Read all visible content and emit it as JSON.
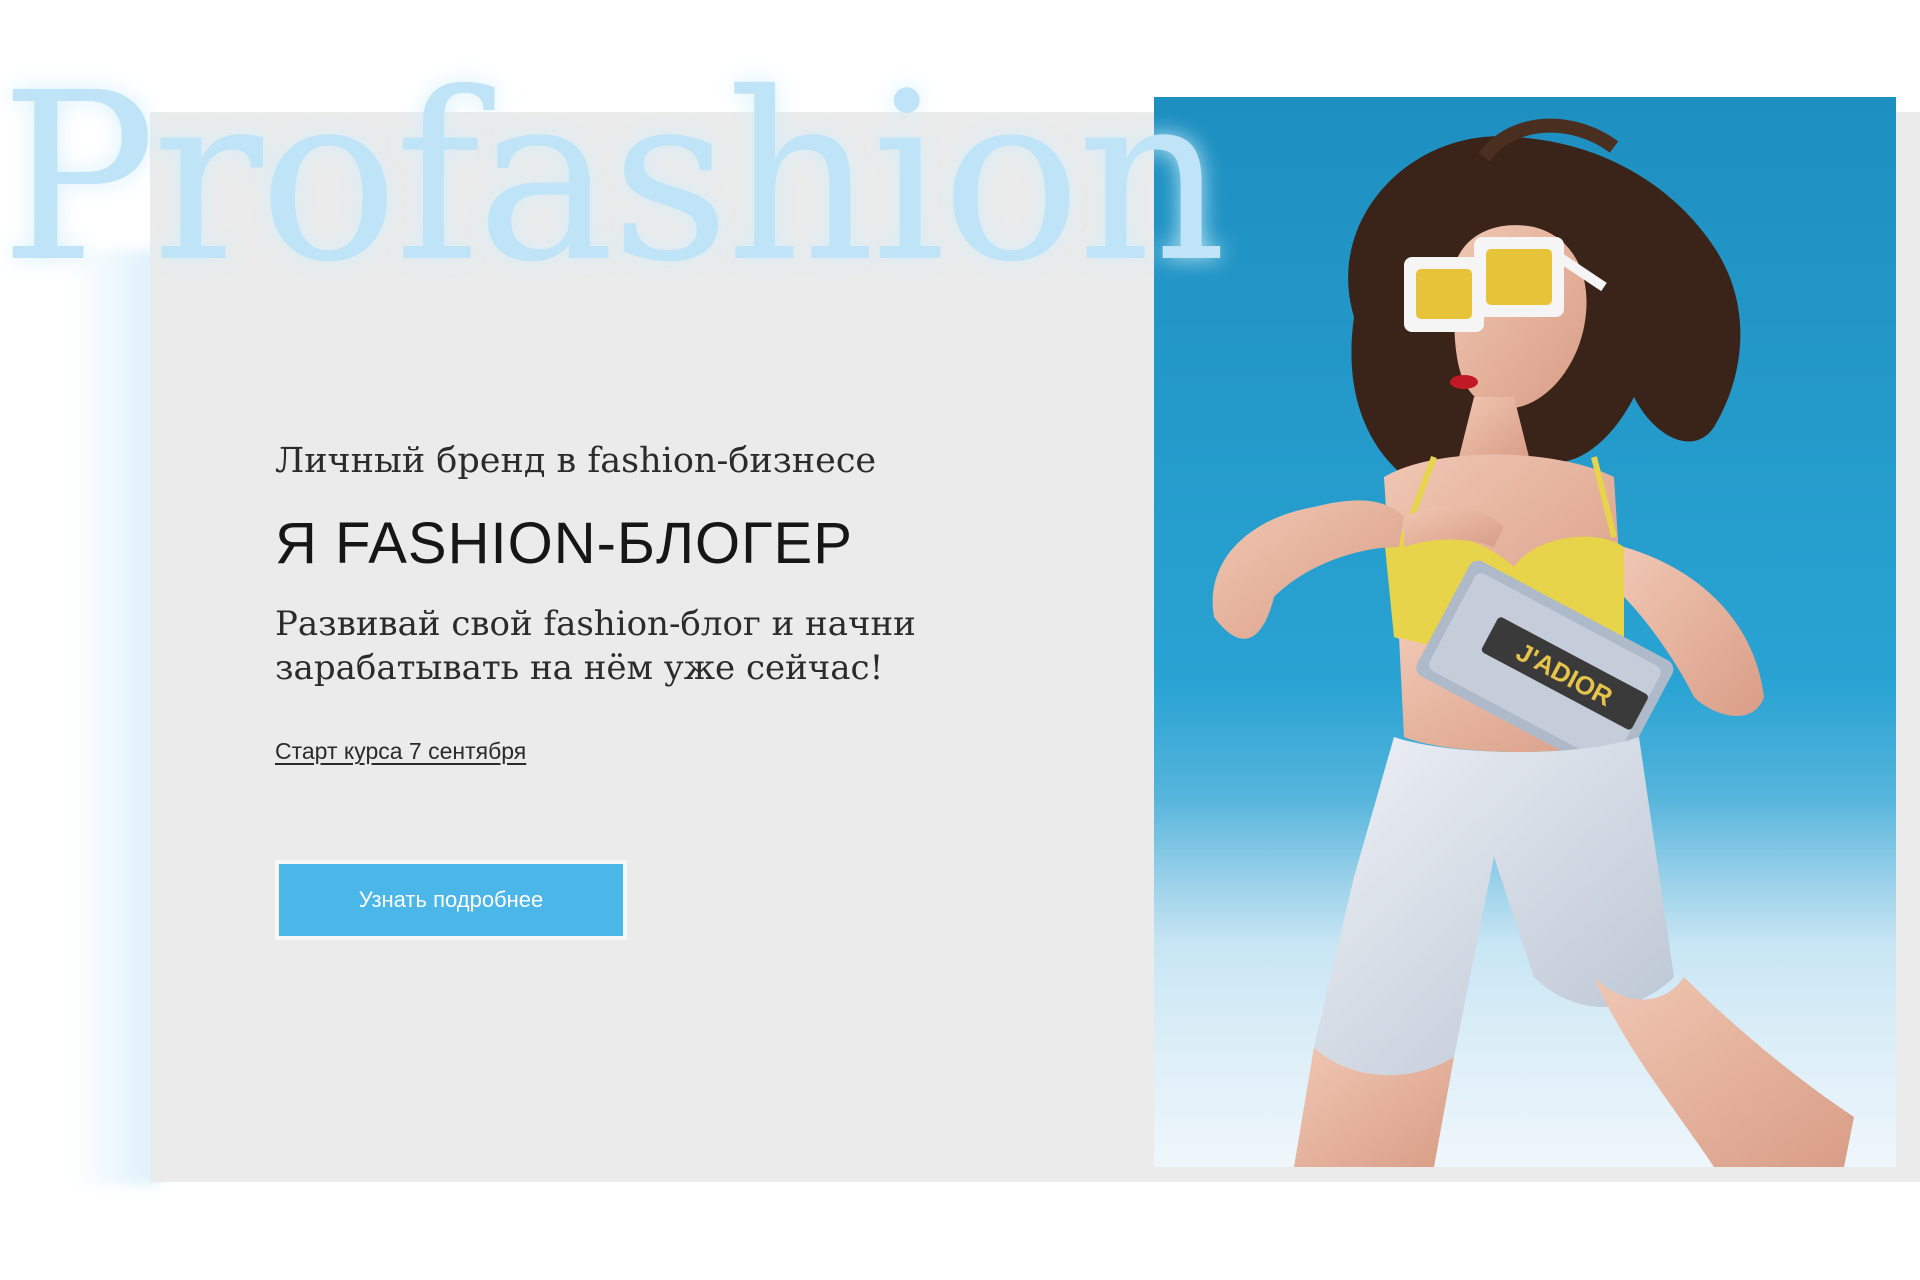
{
  "brand": {
    "watermark": "Profashion"
  },
  "hero": {
    "subtitle": "Личный бренд в fashion-бизнесе",
    "title": "Я FASHION-БЛОГЕР",
    "description": "Развивай свой fashion-блог и начни зарабатывать на нём уже сейчас!",
    "start_link": "Старт курса 7 сентября",
    "cta_label": "Узнать подробнее"
  },
  "photo": {
    "subject": "fashion model in white sunglasses, yellow top and white shorts holding a grey handbag against blue background",
    "bag_text": "J'ADIOR"
  },
  "colors": {
    "accent": "#4bb6e8",
    "panel_background": "#ebebeb",
    "watermark": "#bfe4f7",
    "photo_background": "#1f98c6"
  }
}
